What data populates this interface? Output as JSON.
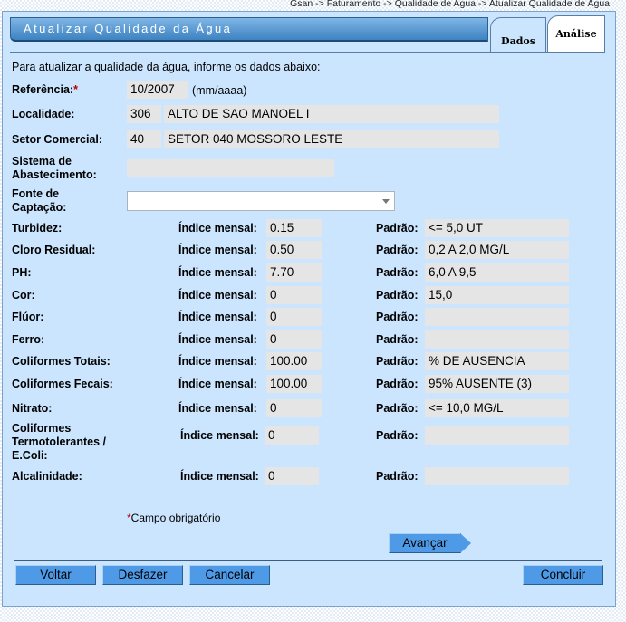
{
  "breadcrumb": "Gsan -> Faturamento -> Qualidade de Agua -> Atualizar Qualidade de Agua",
  "header": {
    "title": "Atualizar Qualidade da Água"
  },
  "tabs": [
    {
      "label": "Dados"
    },
    {
      "label": "Análise"
    }
  ],
  "intro": "Para atualizar a qualidade da água, informe os dados abaixo:",
  "form": {
    "referencia": {
      "label": "Referência:",
      "required_mark": "*",
      "value": "10/2007",
      "hint": "(mm/aaaa)"
    },
    "localidade": {
      "label": "Localidade:",
      "code": "306",
      "name": "ALTO DE SAO MANOEL I"
    },
    "setor": {
      "label": "Setor Comercial:",
      "code": "40",
      "name": "SETOR 040 MOSSORO LESTE"
    },
    "sistema": {
      "label": "Sistema de Abastecimento:",
      "value": ""
    },
    "fonte": {
      "label": "Fonte de Captação:",
      "value": ""
    }
  },
  "parametros": [
    {
      "label": "Turbidez:",
      "indice_label": "Índice mensal:",
      "indice": "0.15",
      "padrao_label": "Padrão:",
      "padrao": "<= 5,0 UT"
    },
    {
      "label": "Cloro Residual:",
      "indice_label": "Índice mensal:",
      "indice": "0.50",
      "padrao_label": "Padrão:",
      "padrao": "0,2 A 2,0 MG/L"
    },
    {
      "label": "PH:",
      "indice_label": "Índice mensal:",
      "indice": "7.70",
      "padrao_label": "Padrão:",
      "padrao": "6,0 A 9,5"
    },
    {
      "label": "Cor:",
      "indice_label": "Índice mensal:",
      "indice": "0",
      "padrao_label": "Padrão:",
      "padrao": "15,0"
    },
    {
      "label": "Flúor:",
      "indice_label": "Índice mensal:",
      "indice": "0",
      "padrao_label": "Padrão:",
      "padrao": ""
    },
    {
      "label": "Ferro:",
      "indice_label": "Índice mensal:",
      "indice": "0",
      "padrao_label": "Padrão:",
      "padrao": ""
    },
    {
      "label": "Coliformes Totais:",
      "indice_label": "Índice mensal:",
      "indice": "100.00",
      "padrao_label": "Padrão:",
      "padrao": "% DE AUSENCIA"
    },
    {
      "label": "Coliformes Fecais:",
      "indice_label": "Índice mensal:",
      "indice": "100.00",
      "padrao_label": "Padrão:",
      "padrao": "95% AUSENTE (3)"
    },
    {
      "label": "Nitrato:",
      "indice_label": "Índice mensal:",
      "indice": "0",
      "padrao_label": "Padrão:",
      "padrao": "<= 10,0 MG/L"
    },
    {
      "label": "Coliformes Termotolerantes / E.Coli:",
      "indice_label": "Índice mensal:",
      "indice": "0",
      "padrao_label": "Padrão:",
      "padrao": ""
    },
    {
      "label": "Alcalinidade:",
      "indice_label": "Índice mensal:",
      "indice": "0",
      "padrao_label": "Padrão:",
      "padrao": ""
    }
  ],
  "required_note": {
    "mark": "*",
    "text": "Campo obrigatório"
  },
  "buttons": {
    "avancar": "Avançar",
    "voltar": "Voltar",
    "desfazer": "Desfazer",
    "cancelar": "Cancelar",
    "concluir": "Concluir"
  },
  "colors": {
    "panel": "#cbe5fe",
    "header": "#3d82c1",
    "button": "#4f9ae6",
    "field": "#e5e5e5"
  }
}
